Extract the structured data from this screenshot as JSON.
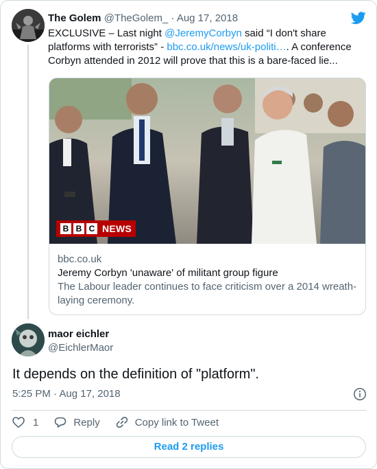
{
  "parent_tweet": {
    "author_name": "The Golem",
    "author_handle": "@TheGolem_",
    "date": "Aug 17, 2018",
    "text_before": "EXCLUSIVE – Last night ",
    "mention": "@JeremyCorbyn",
    "text_middle": " said “I don't share platforms with terrorists” - ",
    "link": "bbc.co.uk/news/uk-politi…",
    "text_after": ". A conference Corbyn attended in 2012 will prove that this is a bare-faced lie...",
    "link_card": {
      "badge_letters": [
        "B",
        "B",
        "C"
      ],
      "badge_word": "NEWS",
      "domain": "bbc.co.uk",
      "title": "Jeremy Corbyn 'unaware' of militant group figure",
      "description": "The Labour leader continues to face criticism over a 2014 wreath-laying ceremony."
    }
  },
  "reply_tweet": {
    "author_name": "maor eichler",
    "author_handle": "@EichlerMaor",
    "text": "It depends on the definition of \"platform\".",
    "timestamp": "5:25 PM · Aug 17, 2018"
  },
  "actions": {
    "like_count": "1",
    "reply_label": "Reply",
    "copy_label": "Copy link to Tweet"
  },
  "read_replies_label": "Read 2 replies",
  "colors": {
    "accent": "#1d9bf0",
    "text": "#0f1419",
    "muted": "#536471",
    "border": "#cfd9de",
    "bbc_red": "#b80000"
  }
}
